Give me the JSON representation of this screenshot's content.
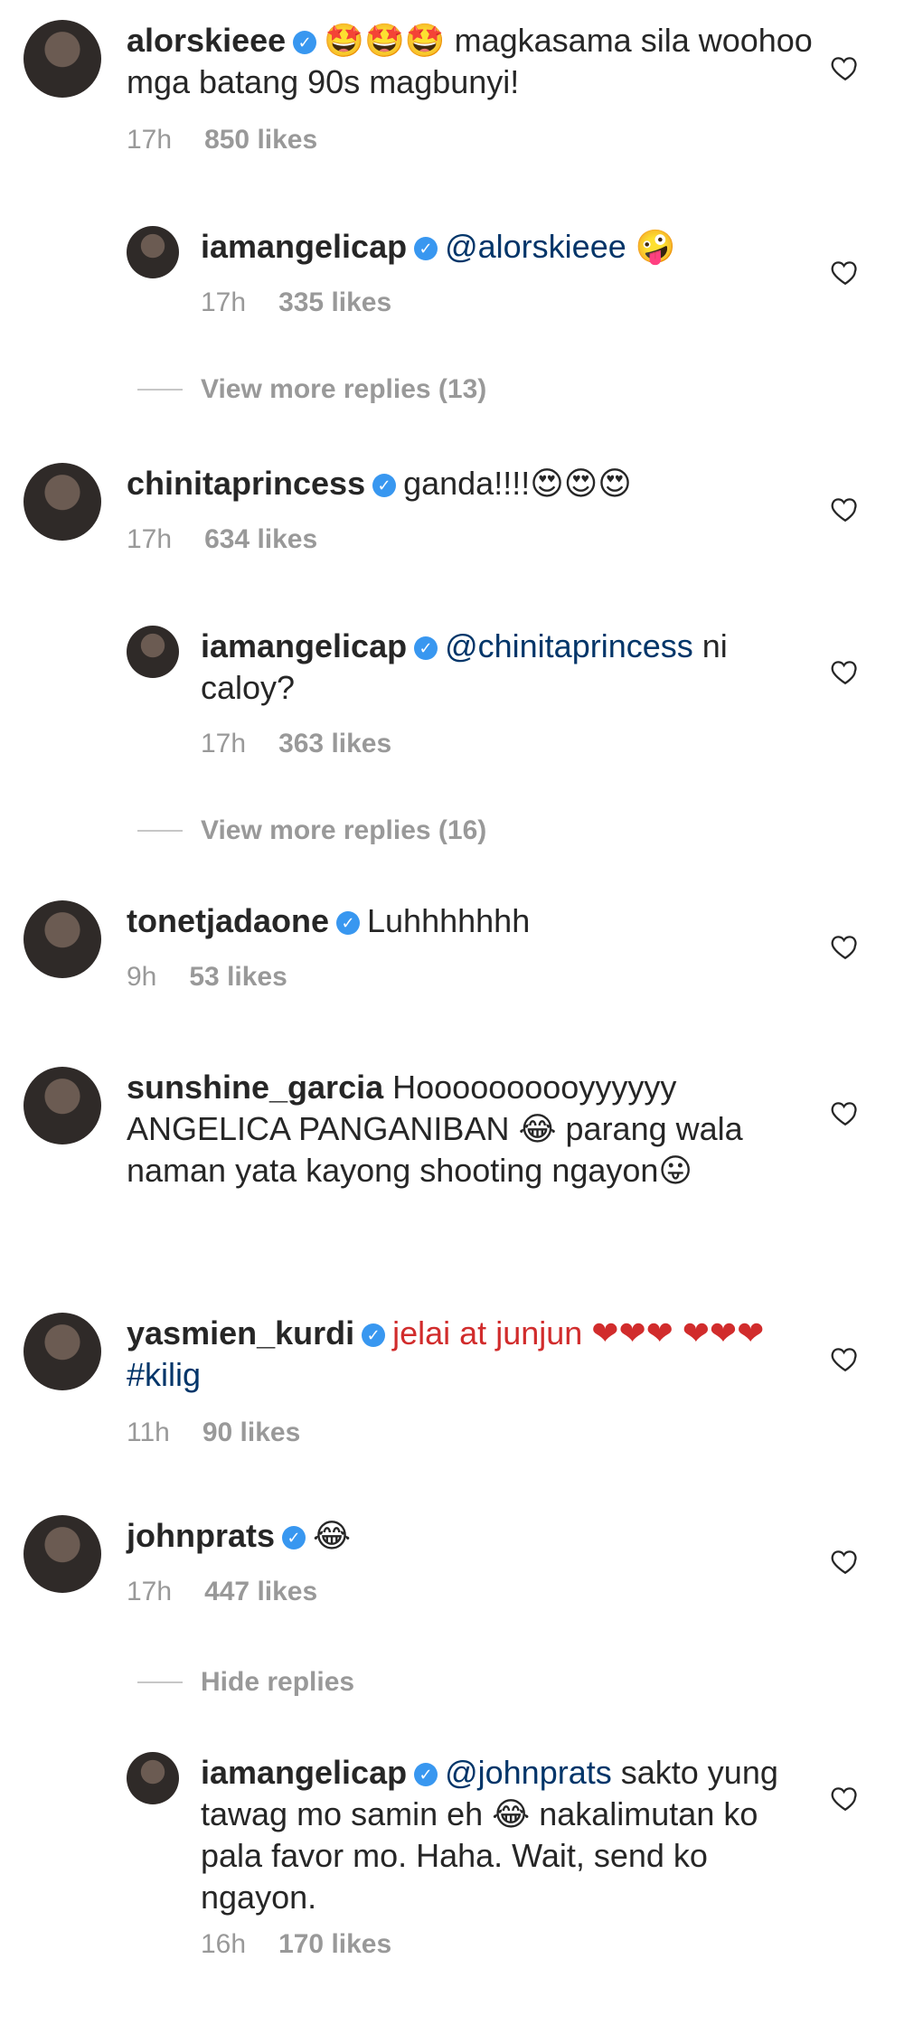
{
  "comments": [
    {
      "user": "alorskieee",
      "verified": true,
      "text": "🤩🤩🤩 magkasama sila woohoo mga batang 90s magbunyi!",
      "time": "17h",
      "likes": "850 likes"
    },
    {
      "user": "iamangelicap",
      "verified": true,
      "mention": "@alorskieee",
      "text": "🤪",
      "time": "17h",
      "likes": "335 likes"
    },
    {
      "more": "View more replies (13)"
    },
    {
      "user": "chinitaprincess",
      "verified": true,
      "text": "ganda!!!!😍😍😍",
      "time": "17h",
      "likes": "634 likes"
    },
    {
      "user": "iamangelicap",
      "verified": true,
      "mention": "@chinitaprincess",
      "text": "ni caloy?",
      "time": "17h",
      "likes": "363 likes"
    },
    {
      "more": "View more replies (16)"
    },
    {
      "user": "tonetjadaone",
      "verified": true,
      "text": "Luhhhhhhh",
      "time": "9h",
      "likes": "53 likes"
    },
    {
      "user": "sunshine_garcia",
      "verified": false,
      "text": "Hoooooooooyyyyyy ANGELICA PANGANIBAN 😂 parang wala naman yata kayong shooting ngayon😛",
      "time": "",
      "likes": ""
    },
    {
      "user": "yasmien_kurdi",
      "verified": true,
      "text": "jelai at junjun ❤❤❤ ❤❤❤",
      "hashtag": "#kilig",
      "time": "11h",
      "likes": "90 likes"
    },
    {
      "user": "johnprats",
      "verified": true,
      "text": "😂",
      "time": "17h",
      "likes": "447 likes"
    },
    {
      "more": "Hide replies"
    },
    {
      "user": "iamangelicap",
      "verified": true,
      "mention": "@johnprats",
      "text": "sakto yung tawag mo samin eh 😂 nakalimutan ko pala favor mo. Haha. Wait, send ko ngayon.",
      "time": "16h",
      "likes": "170 likes"
    }
  ],
  "colors": {
    "verified": "#3897f0",
    "link": "#003569",
    "meta": "#999999"
  }
}
